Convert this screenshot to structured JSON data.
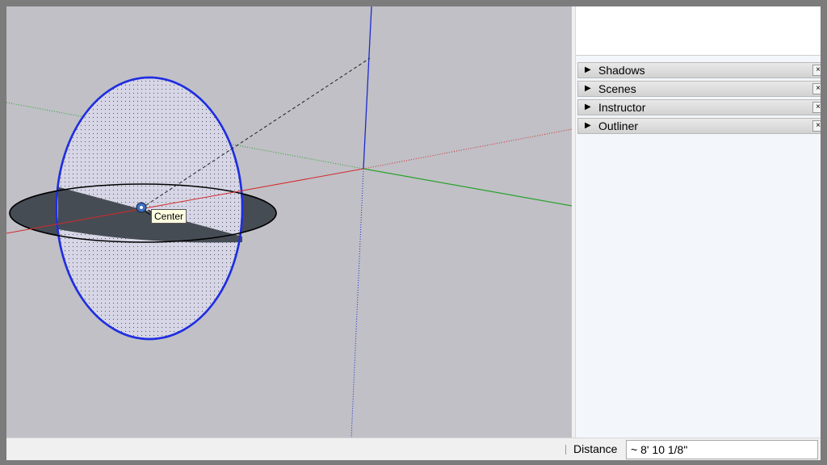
{
  "viewport": {
    "tooltip": "Center",
    "colors": {
      "background": "#c0c0c6",
      "red_axis": "#d42a2a",
      "green_axis": "#2aa12a",
      "blue_axis": "#1a2bd0",
      "circle_edge": "#1f2ee0",
      "circle_face": "#d7d6e6",
      "shadow_disk": "#464c54"
    }
  },
  "trays": [
    {
      "label": "Shadows",
      "expand_icon": "triangle-right-icon",
      "close_icon": "close-icon",
      "close_glyph": "×"
    },
    {
      "label": "Scenes",
      "expand_icon": "triangle-right-icon",
      "close_icon": "close-icon",
      "close_glyph": "×"
    },
    {
      "label": "Instructor",
      "expand_icon": "triangle-right-icon",
      "close_icon": "close-icon",
      "close_glyph": "×"
    },
    {
      "label": "Outliner",
      "expand_icon": "triangle-right-icon",
      "close_icon": "close-icon",
      "close_glyph": "×"
    }
  ],
  "statusbar": {
    "measurement_label": "Distance",
    "measurement_value": "~ 8' 10 1/8\""
  }
}
